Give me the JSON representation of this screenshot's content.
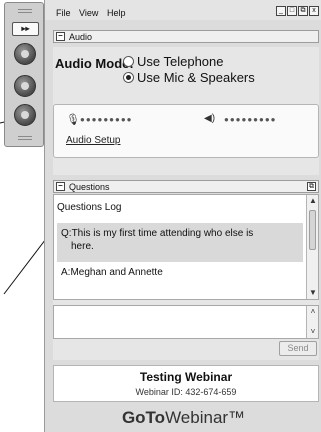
{
  "menu": {
    "file": "File",
    "view": "View",
    "help": "Help"
  },
  "window_buttons": [
    "_",
    "□",
    "⧉",
    "x"
  ],
  "sidebar": {
    "expand_label": "▸▸"
  },
  "audio": {
    "title": "Audio",
    "mode_label": "Audio Mode:",
    "option_telephone": "Use Telephone",
    "option_mic": "Use Mic & Speakers",
    "selected": "Use Mic & Speakers",
    "mic_meter": "●●●●●●●●●",
    "speaker_meter": "●●●●●●●●●",
    "setup_link": "Audio Setup"
  },
  "questions": {
    "title": "Questions",
    "log_title": "Questions Log",
    "question_prefix": "Q:",
    "question_text": "This is my first time attending who else is",
    "question_text_cont": "here.",
    "answer_prefix": "A:",
    "answer_text": "Meghan and Annette",
    "send_label": "Send"
  },
  "webinar": {
    "name": "Testing Webinar",
    "id_text": "Webinar ID: 432-674-659"
  },
  "brand": {
    "goto": "GoTo",
    "webinar": "Webinar™"
  }
}
